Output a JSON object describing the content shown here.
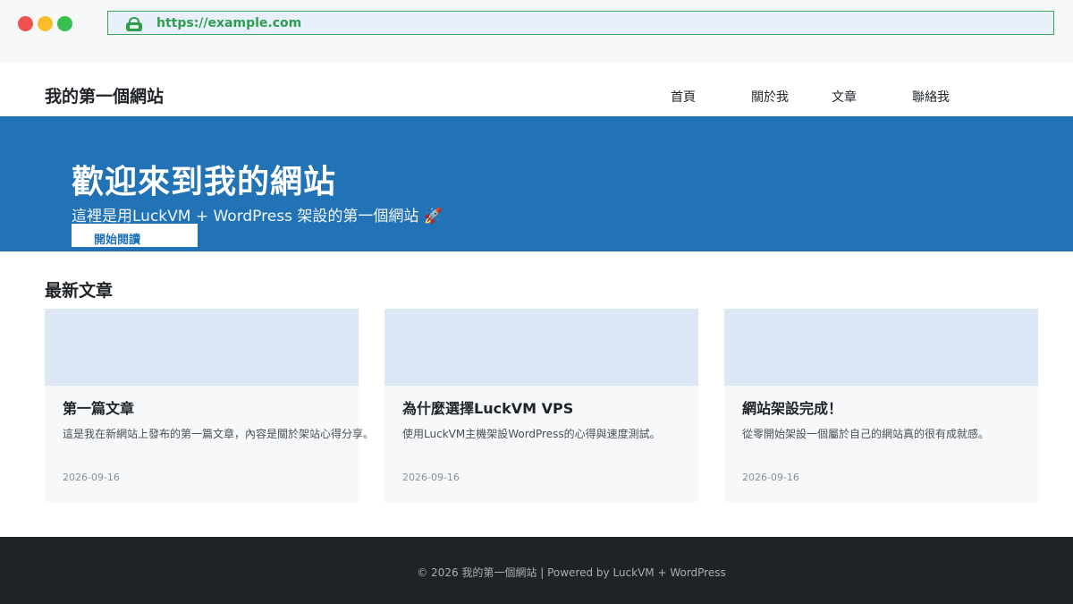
{
  "browser": {
    "url": "https://example.com"
  },
  "header": {
    "site_title": "我的第一個網站",
    "nav": [
      "首頁",
      "關於我",
      "文章",
      "聯絡我"
    ]
  },
  "hero": {
    "title": "歡迎來到我的網站",
    "subtitle": "這裡是用LuckVM + WordPress 架設的第一個網站 🚀",
    "button_label": "開始閱讀"
  },
  "posts": {
    "section_title": "最新文章",
    "items": [
      {
        "title": "第一篇文章",
        "excerpt": "這是我在新網站上發布的第一篇文章，內容是關於架站心得分享。",
        "date": "2026-09-16"
      },
      {
        "title": "為什麼選擇LuckVM VPS",
        "excerpt": "使用LuckVM主機架設WordPress的心得與速度測試。",
        "date": "2026-09-16"
      },
      {
        "title": "網站架設完成！",
        "excerpt": "從零開始架設一個屬於自己的網站真的很有成就感。",
        "date": "2026-09-16"
      }
    ]
  },
  "footer": {
    "text": "© 2026 我的第一個網站 | Powered by LuckVM + WordPress"
  },
  "colors": {
    "hero_bg": "#2273b5",
    "footer_bg": "#1f2326",
    "url_green": "#2e9e4e",
    "card_thumb": "#dce8f5"
  },
  "icons": {
    "address_bar": "lock-icon"
  }
}
